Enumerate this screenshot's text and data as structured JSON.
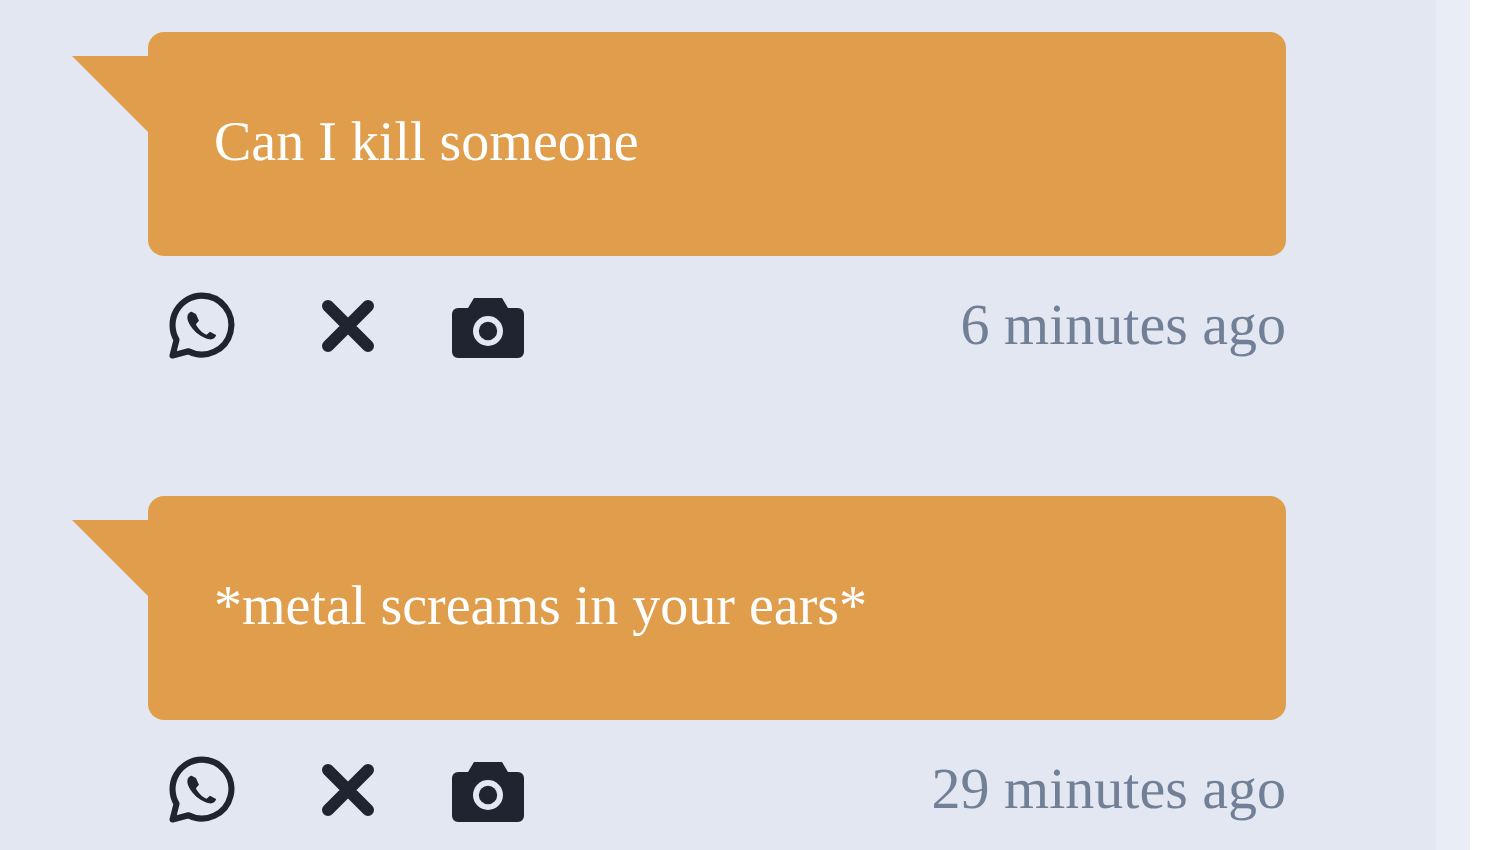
{
  "messages": [
    {
      "text": "Can I kill someone",
      "time": "6 minutes ago"
    },
    {
      "text": "*metal screams in your ears*",
      "time": "29 minutes ago"
    }
  ]
}
